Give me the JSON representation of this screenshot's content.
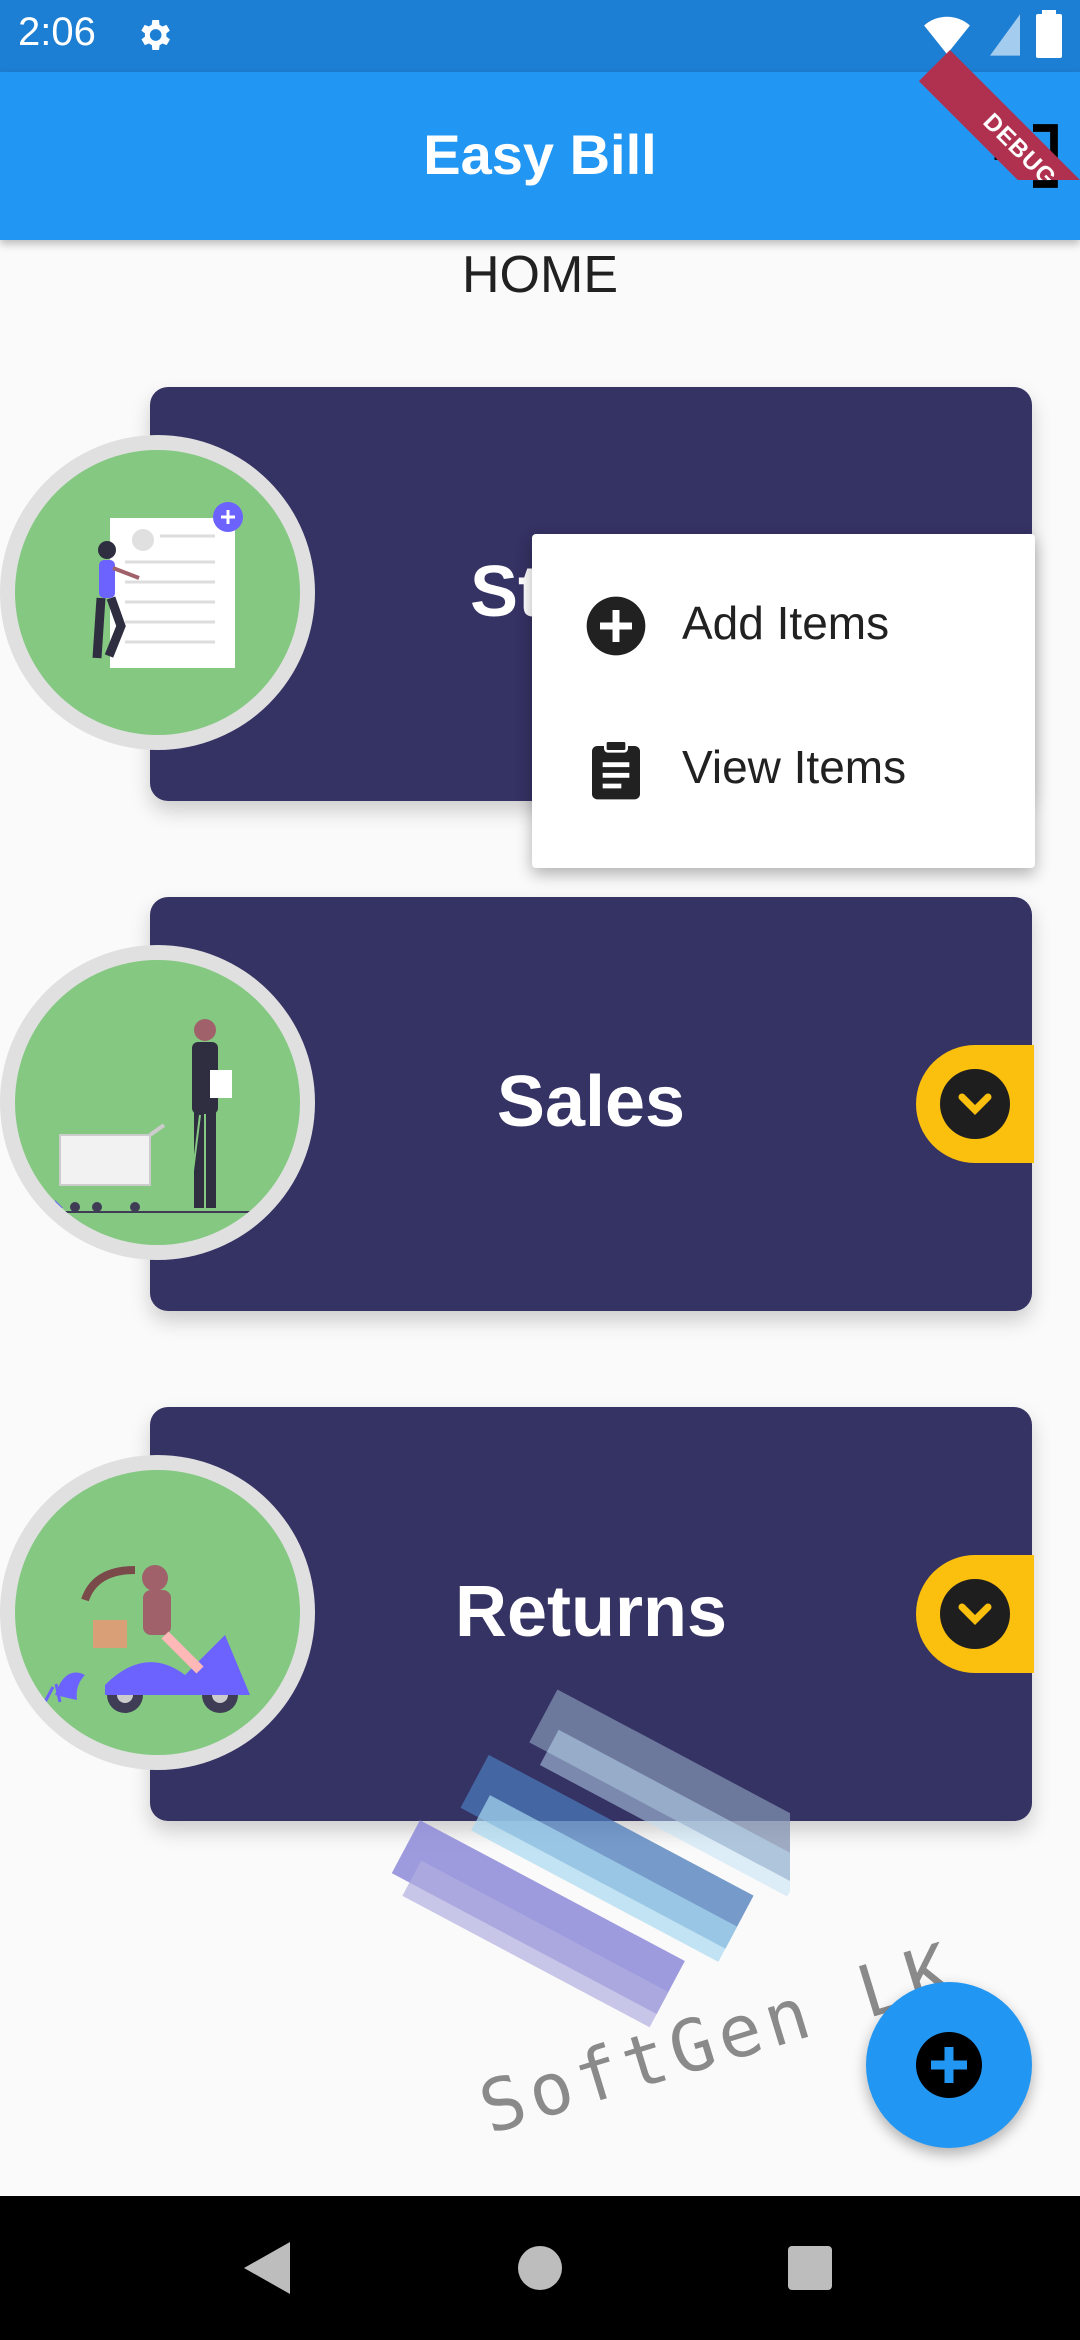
{
  "status_bar": {
    "time": "2:06",
    "debug_label": "DEBUG"
  },
  "app_bar": {
    "title": "Easy Bill",
    "logout_icon": "logout-icon"
  },
  "page": {
    "heading": "HOME"
  },
  "cards": [
    {
      "label": "Stock",
      "visible_label": "St",
      "illustration": "document-person-illustration"
    },
    {
      "label": "Sales",
      "illustration": "shopping-cart-person-illustration"
    },
    {
      "label": "Returns",
      "illustration": "scooter-delivery-illustration"
    }
  ],
  "popup_menu": {
    "items": [
      {
        "label": "Add Items",
        "icon": "add-circle-icon"
      },
      {
        "label": "View Items",
        "icon": "clipboard-icon"
      }
    ]
  },
  "watermark": {
    "text": "SoftGen LK"
  },
  "fab": {
    "icon": "add-circle-icon"
  },
  "colors": {
    "status_bar": "#1d7fd4",
    "app_bar": "#2196f3",
    "card": "#353264",
    "circle": "#84c882",
    "chevron_tab": "#fbbf0e",
    "fab": "#2196f3"
  }
}
